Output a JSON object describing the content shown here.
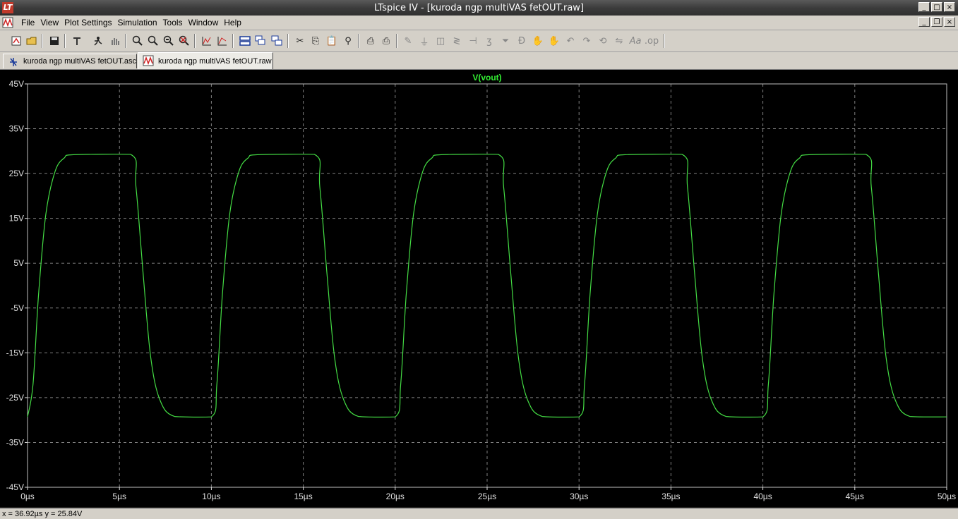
{
  "window": {
    "title": "LTspice IV - [kuroda ngp multiVAS fetOUT.raw]",
    "app_icon_text": "LT"
  },
  "menu": {
    "items": [
      "File",
      "View",
      "Plot Settings",
      "Simulation",
      "Tools",
      "Window",
      "Help"
    ]
  },
  "toolbar": {
    "icons": [
      "open-schematic-icon",
      "open-file-icon",
      "save-icon",
      "control-panel-icon",
      "run-icon",
      "halt-icon",
      "pan-icon",
      "zoom-in-icon",
      "zoom-back-icon",
      "zoom-out-icon",
      "zoom-fit-icon",
      "autorange-icon",
      "grid-icon",
      "tile-horizontal-icon",
      "cascade-icon",
      "tile-vertical-icon",
      "cut-icon",
      "copy-icon",
      "paste-icon",
      "find-icon",
      "print-setup-icon",
      "print-icon",
      "wire-icon",
      "ground-icon",
      "label-icon",
      "resistor-icon",
      "capacitor-icon",
      "inductor-icon",
      "diode-icon",
      "component-icon",
      "move-icon",
      "drag-icon",
      "undo-icon",
      "redo-icon",
      "rotate-icon",
      "mirror-icon",
      "text-icon",
      "spice-directive-icon"
    ]
  },
  "tabs": [
    {
      "label": "kuroda ngp multiVAS fetOUT.asc",
      "active": false
    },
    {
      "label": "kuroda ngp multiVAS fetOUT.raw",
      "active": true
    }
  ],
  "status": {
    "cursor_readout": "x = 36.92µs    y = 25.84V"
  },
  "colors": {
    "trace": "#44dd44",
    "background": "#000000",
    "grid": "#808080",
    "axis_text": "#e0e0e0",
    "title": "#33ee33"
  },
  "chart_data": {
    "type": "line",
    "title": "V(vout)",
    "xlabel": "",
    "ylabel": "",
    "x_unit": "µs",
    "y_unit": "V",
    "xlim": [
      0,
      50
    ],
    "ylim": [
      -45,
      45
    ],
    "x_ticks": [
      "0µs",
      "5µs",
      "10µs",
      "15µs",
      "20µs",
      "25µs",
      "30µs",
      "35µs",
      "40µs",
      "45µs",
      "50µs"
    ],
    "y_ticks": [
      "45V",
      "35V",
      "25V",
      "15V",
      "5V",
      "-5V",
      "-15V",
      "-25V",
      "-35V",
      "-45V"
    ],
    "grid": true,
    "series": [
      {
        "name": "V(vout)",
        "color": "#44dd44",
        "period_us": 10,
        "high_v": 29.3,
        "low_v": -29.3,
        "rise_edges_us": [
          0.2,
          10.2,
          20.2,
          30.2,
          40.2
        ],
        "fall_edges_us": [
          6.0,
          16.0,
          26.0,
          36.0,
          46.0
        ],
        "x": [
          0,
          0.3,
          0.6,
          1.0,
          1.5,
          2.0,
          2.5,
          5.6,
          5.9,
          6.3,
          6.7,
          7.2,
          8.0,
          10.0,
          10.3,
          10.6,
          11.0,
          11.5,
          12.0,
          12.5,
          15.6,
          15.9,
          16.3,
          16.7,
          17.2,
          18.0,
          20.0,
          20.3,
          20.6,
          21.0,
          21.5,
          22.0,
          22.5,
          25.6,
          25.9,
          26.3,
          26.7,
          27.2,
          28.0,
          30.0,
          30.3,
          30.6,
          31.0,
          31.5,
          32.0,
          32.5,
          35.6,
          35.9,
          36.3,
          36.7,
          37.2,
          38.0,
          40.0,
          40.3,
          40.6,
          41.0,
          41.5,
          42.0,
          42.5,
          45.6,
          45.9,
          46.3,
          46.7,
          47.2,
          48.0,
          50.0
        ],
        "y": [
          -29.3,
          -22.0,
          -2.0,
          16.0,
          25.5,
          28.5,
          29.2,
          29.3,
          22.0,
          2.0,
          -16.0,
          -25.5,
          -29.2,
          -29.3,
          -22.0,
          -2.0,
          16.0,
          25.5,
          28.5,
          29.2,
          29.3,
          22.0,
          2.0,
          -16.0,
          -25.5,
          -29.2,
          -29.3,
          -22.0,
          -2.0,
          16.0,
          25.5,
          28.5,
          29.2,
          29.3,
          22.0,
          2.0,
          -16.0,
          -25.5,
          -29.2,
          -29.3,
          -22.0,
          -2.0,
          16.0,
          25.5,
          28.5,
          29.2,
          29.3,
          22.0,
          2.0,
          -16.0,
          -25.5,
          -29.2,
          -29.3,
          -22.0,
          -2.0,
          16.0,
          25.5,
          28.5,
          29.2,
          29.3,
          22.0,
          2.0,
          -16.0,
          -25.5,
          -29.2,
          -29.3
        ]
      }
    ]
  }
}
